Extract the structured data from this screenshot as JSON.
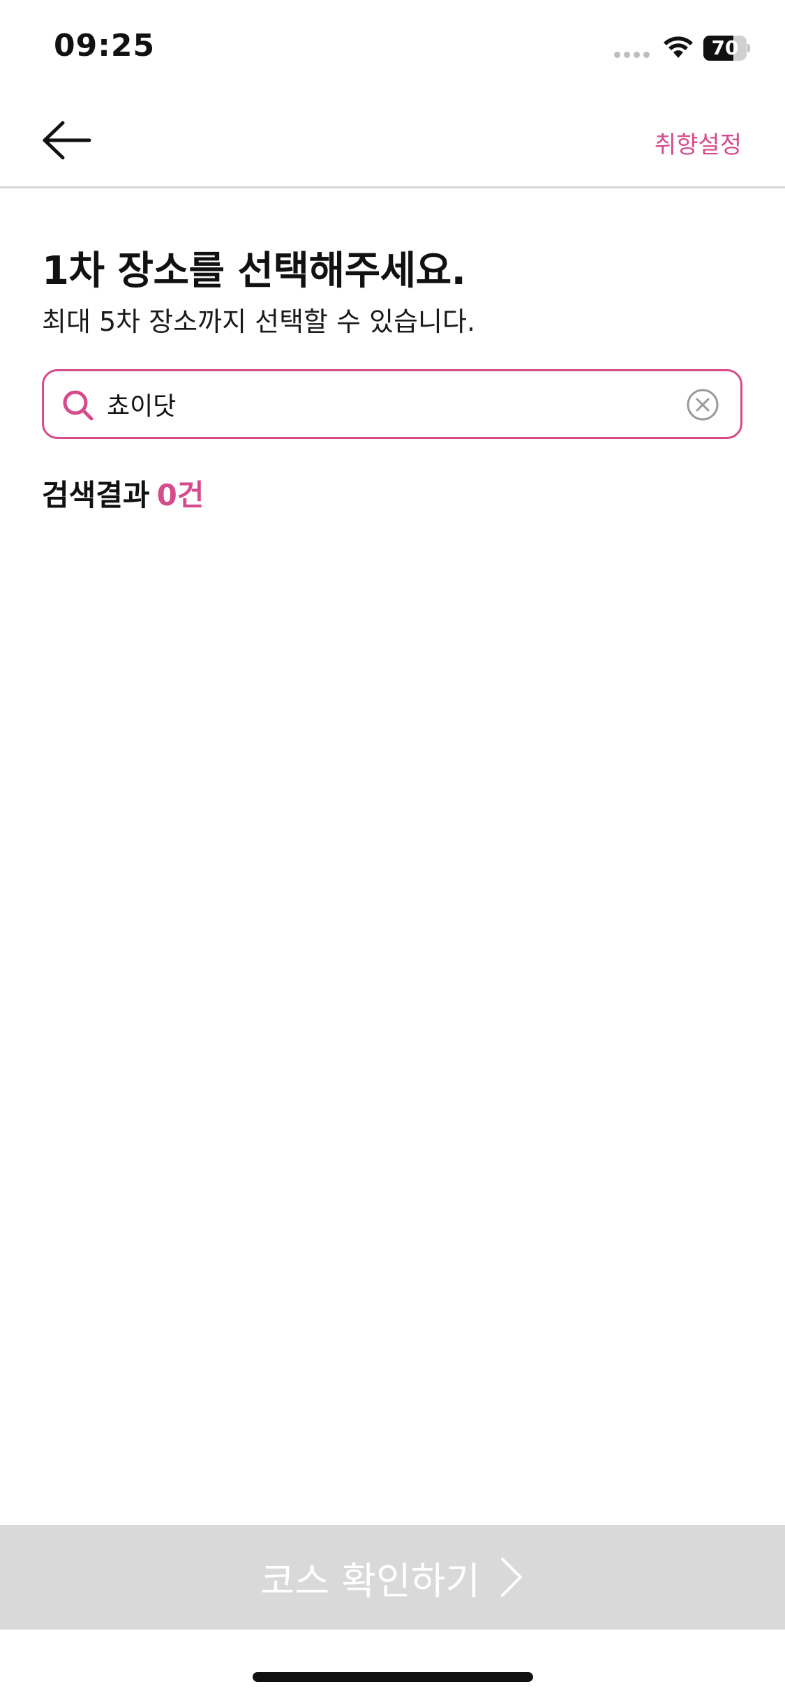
{
  "status_bar": {
    "time": "09:25",
    "battery_level": "70",
    "battery_fraction": 0.7
  },
  "header": {
    "back_icon": "arrow-left-icon",
    "preference_label": "취향설정"
  },
  "main": {
    "title": "1차 장소를 선택해주세요.",
    "subtitle": "최대 5차 장소까지 선택할 수 있습니다."
  },
  "search": {
    "value": "쵸이닷",
    "search_icon": "search-icon",
    "clear_icon": "clear-circle-icon"
  },
  "results": {
    "label": "검색결과",
    "count": "0건"
  },
  "cta": {
    "label": "코스 확인하기",
    "icon": "chevron-right-icon"
  },
  "colors": {
    "accent": "#d64b8c",
    "cta_disabled": "#d9d9d9",
    "divider": "#d6d6d6"
  }
}
